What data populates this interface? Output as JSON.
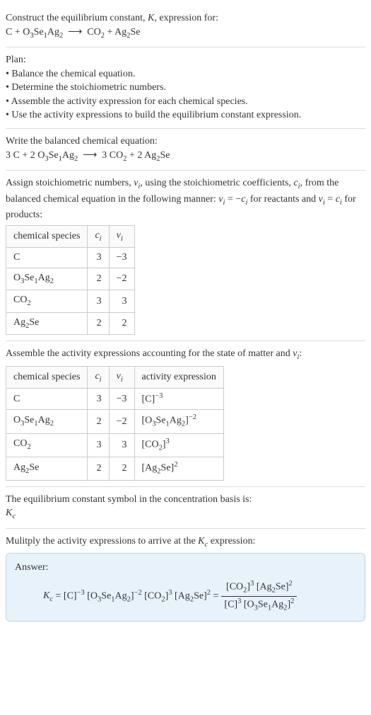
{
  "intro": {
    "line1_html": "Construct the equilibrium constant, <i>K</i>, expression for:",
    "line2_html": "C + O<sub>3</sub>Se<sub>1</sub>Ag<sub>2</sub> &nbsp;⟶&nbsp; CO<sub>2</sub> + Ag<sub>2</sub>Se"
  },
  "plan": {
    "heading": "Plan:",
    "items": [
      "• Balance the chemical equation.",
      "• Determine the stoichiometric numbers.",
      "• Assemble the activity expression for each chemical species.",
      "• Use the activity expressions to build the equilibrium constant expression."
    ]
  },
  "balanced": {
    "heading": "Write the balanced chemical equation:",
    "eq_html": "3 C + 2 O<sub>3</sub>Se<sub>1</sub>Ag<sub>2</sub> &nbsp;⟶&nbsp; 3 CO<sub>2</sub> + 2 Ag<sub>2</sub>Se"
  },
  "stoich": {
    "intro_html": "Assign stoichiometric numbers, <i>ν<sub>i</sub></i>, using the stoichiometric coefficients, <i>c<sub>i</sub></i>, from the balanced chemical equation in the following manner: <i>ν<sub>i</sub></i> = −<i>c<sub>i</sub></i> for reactants and <i>ν<sub>i</sub></i> = <i>c<sub>i</sub></i> for products:",
    "headers": {
      "species": "chemical species",
      "ci_html": "<i>c<sub>i</sub></i>",
      "vi_html": "<i>ν<sub>i</sub></i>"
    },
    "rows": [
      {
        "species_html": "C",
        "ci": "3",
        "vi": "−3"
      },
      {
        "species_html": "O<sub>3</sub>Se<sub>1</sub>Ag<sub>2</sub>",
        "ci": "2",
        "vi": "−2"
      },
      {
        "species_html": "CO<sub>2</sub>",
        "ci": "3",
        "vi": "3"
      },
      {
        "species_html": "Ag<sub>2</sub>Se",
        "ci": "2",
        "vi": "2"
      }
    ]
  },
  "activity": {
    "intro_html": "Assemble the activity expressions accounting for the state of matter and <i>ν<sub>i</sub></i>:",
    "headers": {
      "species": "chemical species",
      "ci_html": "<i>c<sub>i</sub></i>",
      "vi_html": "<i>ν<sub>i</sub></i>",
      "activity": "activity expression"
    },
    "rows": [
      {
        "species_html": "C",
        "ci": "3",
        "vi": "−3",
        "act_html": "[C]<sup>−3</sup>"
      },
      {
        "species_html": "O<sub>3</sub>Se<sub>1</sub>Ag<sub>2</sub>",
        "ci": "2",
        "vi": "−2",
        "act_html": "[O<sub>3</sub>Se<sub>1</sub>Ag<sub>2</sub>]<sup>−2</sup>"
      },
      {
        "species_html": "CO<sub>2</sub>",
        "ci": "3",
        "vi": "3",
        "act_html": "[CO<sub>2</sub>]<sup>3</sup>"
      },
      {
        "species_html": "Ag<sub>2</sub>Se",
        "ci": "2",
        "vi": "2",
        "act_html": "[Ag<sub>2</sub>Se]<sup>2</sup>"
      }
    ]
  },
  "basis": {
    "line1": "The equilibrium constant symbol in the concentration basis is:",
    "line2_html": "<i>K<sub>c</sub></i>"
  },
  "final": {
    "intro_html": "Mulitply the activity expressions to arrive at the <i>K<sub>c</sub></i> expression:",
    "answer_label": "Answer:",
    "lhs_html": "<i>K<sub>c</sub></i> = [C]<sup>−3</sup> [O<sub>3</sub>Se<sub>1</sub>Ag<sub>2</sub>]<sup>−2</sup> [CO<sub>2</sub>]<sup>3</sup> [Ag<sub>2</sub>Se]<sup>2</sup> = ",
    "frac_num_html": "[CO<sub>2</sub>]<sup>3</sup> [Ag<sub>2</sub>Se]<sup>2</sup>",
    "frac_den_html": "[C]<sup>3</sup> [O<sub>3</sub>Se<sub>1</sub>Ag<sub>2</sub>]<sup>2</sup>"
  }
}
